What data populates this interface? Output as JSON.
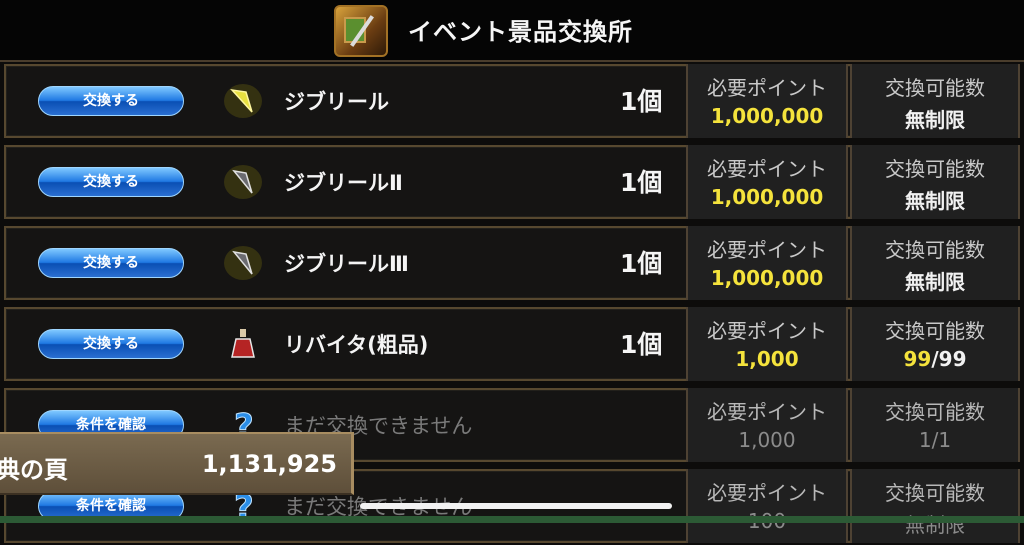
{
  "header": {
    "title": "イベント景品交換所",
    "icon": "treasure-box-icon"
  },
  "labels": {
    "points": "必要ポイント",
    "limit": "交換可能数"
  },
  "rows": [
    {
      "button": "交換する",
      "icon": "gem-yellow-icon",
      "name": "ジブリール",
      "qty": "1個",
      "points": "1,000,000",
      "limit": "無制限"
    },
    {
      "button": "交換する",
      "icon": "gem-silver-icon",
      "name": "ジブリールⅡ",
      "qty": "1個",
      "points": "1,000,000",
      "limit": "無制限"
    },
    {
      "button": "交換する",
      "icon": "gem-silver-icon",
      "name": "ジブリールⅢ",
      "qty": "1個",
      "points": "1,000,000",
      "limit": "無制限"
    },
    {
      "button": "交換する",
      "icon": "potion-icon",
      "name": "リバイタ(粗品)",
      "qty": "1個",
      "points": "1,000",
      "limit_have": "99",
      "limit_max": "/99"
    },
    {
      "button": "条件を確認",
      "icon": "question-icon",
      "name": "まだ交換できません",
      "points": "1,000",
      "limit": "1/1"
    },
    {
      "button": "条件を確認",
      "icon": "question-icon",
      "name": "まだ交換できません",
      "points": "100",
      "limit": "無制限"
    }
  ],
  "points_bar": {
    "label": "典の頁",
    "value": "1,131,925"
  }
}
